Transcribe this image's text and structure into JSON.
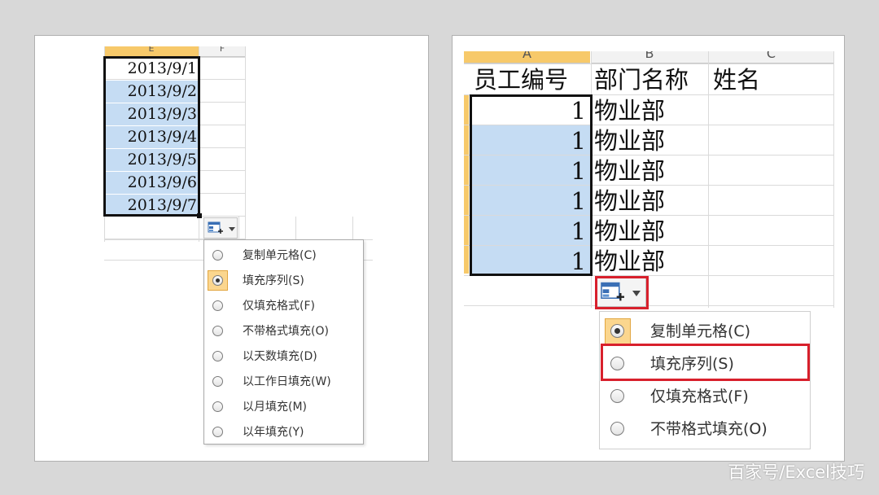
{
  "left": {
    "col_headers": [
      "E",
      "F"
    ],
    "dates": [
      "2013/9/1",
      "2013/9/2",
      "2013/9/3",
      "2013/9/4",
      "2013/9/5",
      "2013/9/6",
      "2013/9/7"
    ],
    "menu_items": [
      {
        "label": "复制单元格(C)",
        "selected": false
      },
      {
        "label": "填充序列(S)",
        "selected": true
      },
      {
        "label": "仅填充格式(F)",
        "selected": false
      },
      {
        "label": "不带格式填充(O)",
        "selected": false
      },
      {
        "label": "以天数填充(D)",
        "selected": false
      },
      {
        "label": "以工作日填充(W)",
        "selected": false
      },
      {
        "label": "以月填充(M)",
        "selected": false
      },
      {
        "label": "以年填充(Y)",
        "selected": false
      }
    ]
  },
  "right": {
    "col_headers": [
      "A",
      "B",
      "C"
    ],
    "header_row": [
      "员工编号",
      "部门名称",
      "姓名"
    ],
    "rows": [
      {
        "id": "1",
        "dept": "物业部"
      },
      {
        "id": "1",
        "dept": "物业部"
      },
      {
        "id": "1",
        "dept": "物业部"
      },
      {
        "id": "1",
        "dept": "物业部"
      },
      {
        "id": "1",
        "dept": "物业部"
      },
      {
        "id": "1",
        "dept": "物业部"
      }
    ],
    "menu_items": [
      {
        "label": "复制单元格(C)",
        "selected": true
      },
      {
        "label": "填充序列(S)",
        "selected": false
      },
      {
        "label": "仅填充格式(F)",
        "selected": false
      },
      {
        "label": "不带格式填充(O)",
        "selected": false
      }
    ]
  },
  "watermark": "百家号/Excel技巧",
  "colors": {
    "selection_fill": "#c5dcf3",
    "header_selected": "#f7c96a",
    "highlight_red": "#d8202c"
  }
}
